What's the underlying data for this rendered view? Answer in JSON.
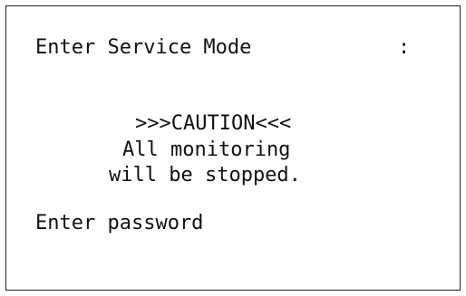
{
  "screen": {
    "title": "Enter Service Mode",
    "title_separator": ":",
    "caution_heading": ">>>CAUTION<<<",
    "caution_line_1": "All monitoring",
    "caution_line_2": "will be stopped.",
    "prompt": "Enter password"
  }
}
